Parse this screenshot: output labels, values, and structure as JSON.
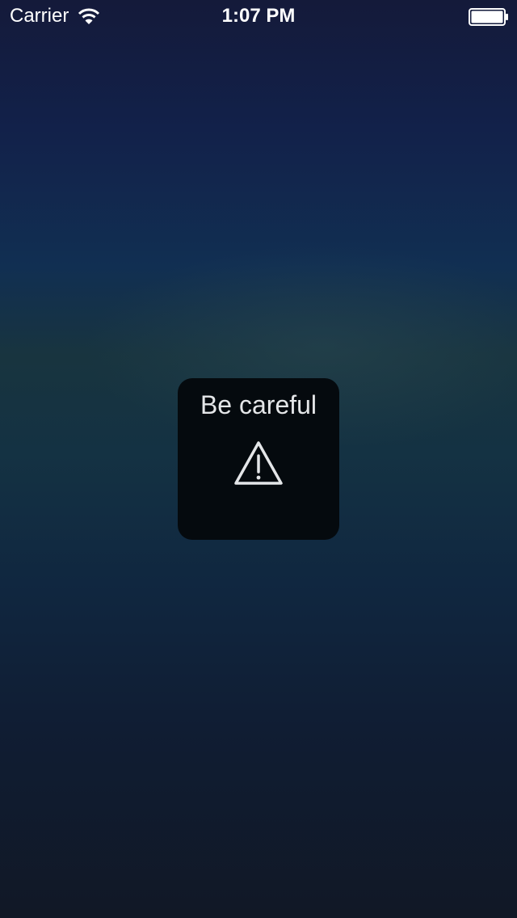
{
  "status_bar": {
    "carrier": "Carrier",
    "time": "1:07 PM",
    "icons": [
      "wifi-icon",
      "battery-icon"
    ]
  },
  "hud": {
    "title": "Be careful",
    "icon": "warning-icon"
  },
  "colors": {
    "hud_background": "#050a0e",
    "text": "#e4e6e8",
    "status_text": "#ffffff"
  }
}
